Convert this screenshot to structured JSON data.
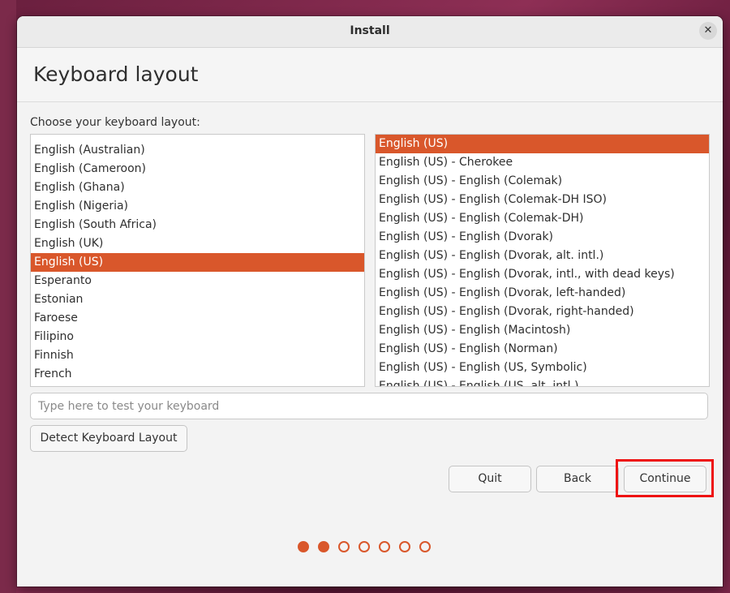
{
  "window": {
    "title": "Install"
  },
  "page": {
    "title": "Keyboard layout",
    "choose_label": "Choose your keyboard layout:"
  },
  "layouts": {
    "items": [
      "English (Australian)",
      "English (Cameroon)",
      "English (Ghana)",
      "English (Nigeria)",
      "English (South Africa)",
      "English (UK)",
      "English (US)",
      "Esperanto",
      "Estonian",
      "Faroese",
      "Filipino",
      "Finnish",
      "French"
    ],
    "selected": "English (US)"
  },
  "variants": {
    "items": [
      "English (US)",
      "English (US) - Cherokee",
      "English (US) - English (Colemak)",
      "English (US) - English (Colemak-DH ISO)",
      "English (US) - English (Colemak-DH)",
      "English (US) - English (Dvorak)",
      "English (US) - English (Dvorak, alt. intl.)",
      "English (US) - English (Dvorak, intl., with dead keys)",
      "English (US) - English (Dvorak, left-handed)",
      "English (US) - English (Dvorak, right-handed)",
      "English (US) - English (Macintosh)",
      "English (US) - English (Norman)",
      "English (US) - English (US, Symbolic)",
      "English (US) - English (US, alt. intl.)"
    ],
    "selected": "English (US)"
  },
  "test_input": {
    "placeholder": "Type here to test your keyboard",
    "value": ""
  },
  "buttons": {
    "detect": "Detect Keyboard Layout",
    "quit": "Quit",
    "back": "Back",
    "continue": "Continue"
  },
  "progress": {
    "total_steps": 7,
    "completed_steps": 2
  },
  "colors": {
    "accent": "#d9572b",
    "highlight": "#ee1111"
  }
}
